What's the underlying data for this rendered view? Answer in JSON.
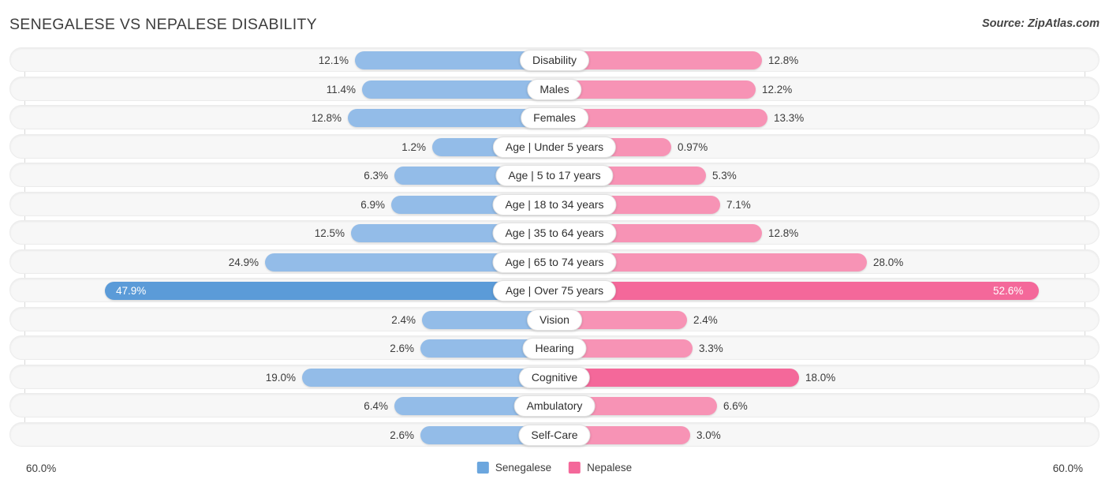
{
  "header": {
    "title": "SENEGALESE VS NEPALESE DISABILITY",
    "source": "Source: ZipAtlas.com"
  },
  "footer": {
    "axis_left": "60.0%",
    "axis_right": "60.0%",
    "legend": [
      {
        "label": "Senegalese",
        "color": "#6ba6de"
      },
      {
        "label": "Nepalese",
        "color": "#f4689a"
      }
    ]
  },
  "chart_data": {
    "type": "bar",
    "title": "SENEGALESE VS NEPALESE DISABILITY",
    "subtitle": "Source: ZipAtlas.com",
    "orientation": "horizontal-diverging",
    "xlabel": "",
    "ylabel": "",
    "xlim": [
      60.0,
      60.0
    ],
    "axis_max_percent": 60.0,
    "grid": false,
    "legend_position": "bottom-center",
    "categories": [
      "Disability",
      "Males",
      "Females",
      "Age | Under 5 years",
      "Age | 5 to 17 years",
      "Age | 18 to 34 years",
      "Age | 35 to 64 years",
      "Age | 65 to 74 years",
      "Age | Over 75 years",
      "Vision",
      "Hearing",
      "Cognitive",
      "Ambulatory",
      "Self-Care"
    ],
    "series": [
      {
        "name": "Senegalese",
        "color": "#93bce8",
        "values": [
          12.1,
          11.4,
          12.8,
          1.2,
          6.3,
          6.9,
          12.5,
          24.9,
          47.9,
          2.4,
          2.6,
          19.0,
          6.4,
          2.6
        ],
        "labels": [
          "12.1%",
          "11.4%",
          "12.8%",
          "1.2%",
          "6.3%",
          "6.9%",
          "12.5%",
          "24.9%",
          "47.9%",
          "2.4%",
          "2.6%",
          "19.0%",
          "6.4%",
          "2.6%"
        ]
      },
      {
        "name": "Nepalese",
        "color": "#f793b5",
        "values": [
          12.8,
          12.2,
          13.3,
          0.97,
          5.3,
          7.1,
          12.8,
          28.0,
          52.6,
          2.4,
          3.3,
          18.0,
          6.6,
          3.0
        ],
        "labels": [
          "12.8%",
          "12.2%",
          "13.3%",
          "0.97%",
          "5.3%",
          "7.1%",
          "12.8%",
          "28.0%",
          "52.6%",
          "2.4%",
          "3.3%",
          "18.0%",
          "6.6%",
          "3.0%"
        ]
      }
    ]
  },
  "rows": [
    {
      "label": "Disability",
      "left_label": "12.1%",
      "right_label": "12.8%",
      "left_w": 253,
      "right_w": 263,
      "left_style": "blue-lt",
      "right_style": "pink-lt",
      "left_inside": false,
      "right_inside": false
    },
    {
      "label": "Males",
      "left_label": "11.4%",
      "right_label": "12.2%",
      "left_w": 244,
      "right_w": 255,
      "left_style": "blue-lt",
      "right_style": "pink-lt",
      "left_inside": false,
      "right_inside": false
    },
    {
      "label": "Females",
      "left_label": "12.8%",
      "right_label": "13.3%",
      "left_w": 262,
      "right_w": 270,
      "left_style": "blue-lt",
      "right_style": "pink-lt",
      "left_inside": false,
      "right_inside": false
    },
    {
      "label": "Age | Under 5 years",
      "left_label": "1.2%",
      "right_label": "0.97%",
      "left_w": 155,
      "right_w": 148,
      "left_style": "blue-lt",
      "right_style": "pink-lt",
      "left_inside": false,
      "right_inside": false
    },
    {
      "label": "Age | 5 to 17 years",
      "left_label": "6.3%",
      "right_label": "5.3%",
      "left_w": 203,
      "right_w": 192,
      "left_style": "blue-lt",
      "right_style": "pink-lt",
      "left_inside": false,
      "right_inside": false
    },
    {
      "label": "Age | 18 to 34 years",
      "left_label": "6.9%",
      "right_label": "7.1%",
      "left_w": 207,
      "right_w": 210,
      "left_style": "blue-lt",
      "right_style": "pink-lt",
      "left_inside": false,
      "right_inside": false
    },
    {
      "label": "Age | 35 to 64 years",
      "left_label": "12.5%",
      "right_label": "12.8%",
      "left_w": 258,
      "right_w": 263,
      "left_style": "blue-lt",
      "right_style": "pink-lt",
      "left_inside": false,
      "right_inside": false
    },
    {
      "label": "Age | 65 to 74 years",
      "left_label": "24.9%",
      "right_label": "28.0%",
      "left_w": 367,
      "right_w": 396,
      "left_style": "blue-lt",
      "right_style": "pink-lt",
      "left_inside": false,
      "right_inside": false
    },
    {
      "label": "Age | Over 75 years",
      "left_label": "47.9%",
      "right_label": "52.6%",
      "left_w": 570,
      "right_w": 614,
      "left_style": "blue-dk",
      "right_style": "pink-dk",
      "left_inside": true,
      "right_inside": true
    },
    {
      "label": "Vision",
      "left_label": "2.4%",
      "right_label": "2.4%",
      "left_w": 168,
      "right_w": 168,
      "left_style": "blue-lt",
      "right_style": "pink-lt",
      "left_inside": false,
      "right_inside": false
    },
    {
      "label": "Hearing",
      "left_label": "2.6%",
      "right_label": "3.3%",
      "left_w": 170,
      "right_w": 175,
      "left_style": "blue-lt",
      "right_style": "pink-lt",
      "left_inside": false,
      "right_inside": false
    },
    {
      "label": "Cognitive",
      "left_label": "19.0%",
      "right_label": "18.0%",
      "left_w": 320,
      "right_w": 310,
      "left_style": "blue-lt",
      "right_style": "pink-dk",
      "left_inside": false,
      "right_inside": false
    },
    {
      "label": "Ambulatory",
      "left_label": "6.4%",
      "right_label": "6.6%",
      "left_w": 203,
      "right_w": 206,
      "left_style": "blue-lt",
      "right_style": "pink-lt",
      "left_inside": false,
      "right_inside": false
    },
    {
      "label": "Self-Care",
      "left_label": "2.6%",
      "right_label": "3.0%",
      "left_w": 170,
      "right_w": 172,
      "left_style": "blue-lt",
      "right_style": "pink-lt",
      "left_inside": false,
      "right_inside": false
    }
  ]
}
